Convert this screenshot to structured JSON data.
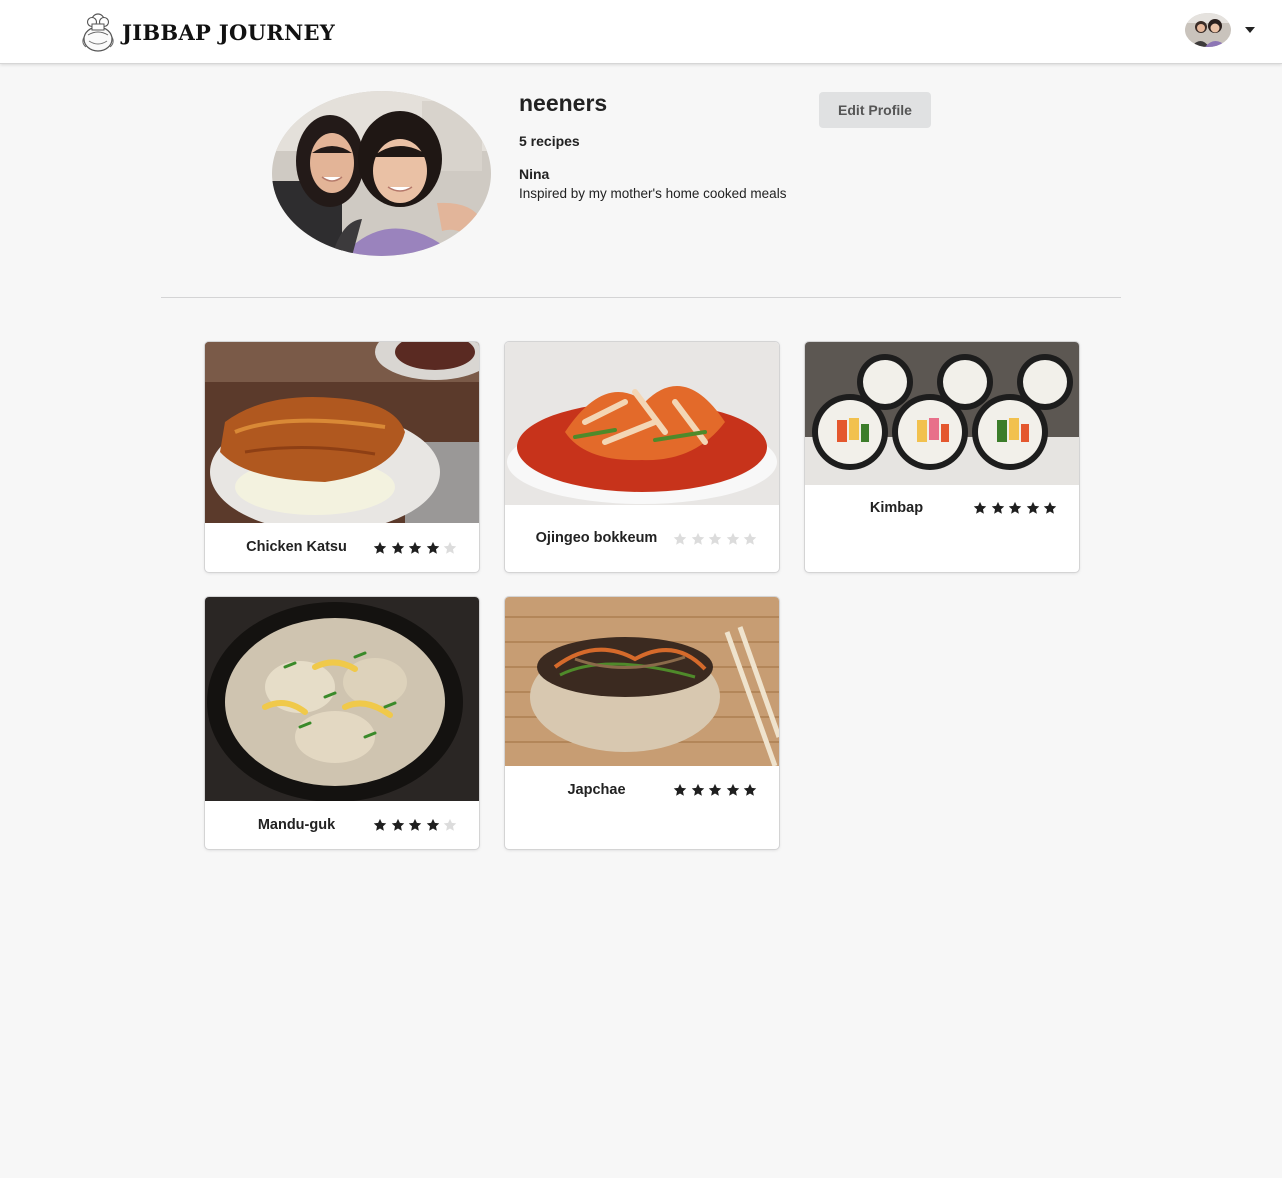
{
  "header": {
    "brand": "JIBBAP JOURNEY",
    "logo_icon": "chef-pot-logo-icon",
    "user_avatar_icon": "user-avatar-icon",
    "menu_icon": "caret-down-icon"
  },
  "profile": {
    "username": "neeners",
    "recipe_count": "5 recipes",
    "display_name": "Nina",
    "bio": "Inspired by my mother's home cooked meals",
    "edit_button": "Edit Profile"
  },
  "recipes": [
    {
      "name": "Chicken Katsu",
      "rating": 4,
      "max_rating": 5
    },
    {
      "name": "Ojingeo bokkeum",
      "rating": 0,
      "max_rating": 5
    },
    {
      "name": "Kimbap",
      "rating": 5,
      "max_rating": 5
    },
    {
      "name": "Mandu-guk",
      "rating": 4,
      "max_rating": 5
    },
    {
      "name": "Japchae",
      "rating": 5,
      "max_rating": 5
    }
  ],
  "colors": {
    "page_background": "#f7f7f7",
    "star_filled": "#1f1f1f",
    "star_empty": "#dcdcdc",
    "button_background": "#e0e1e2"
  }
}
